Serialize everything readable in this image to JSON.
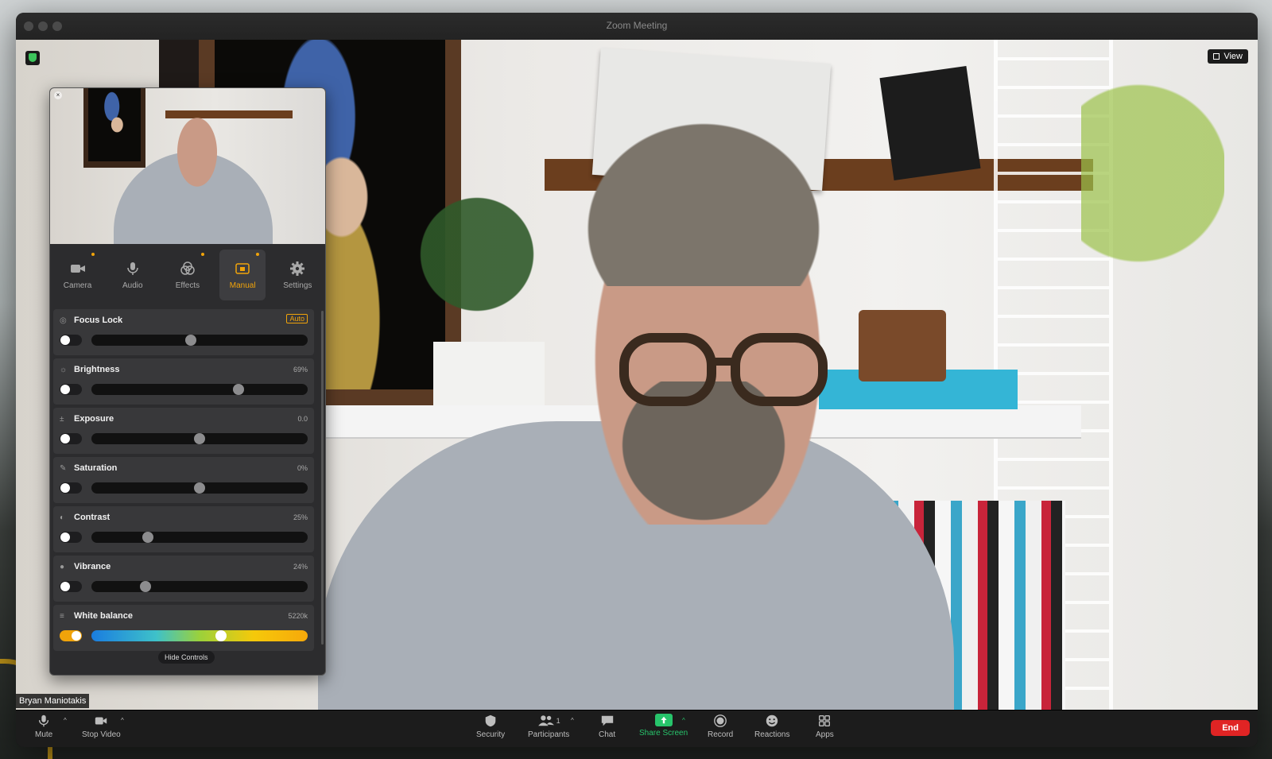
{
  "window": {
    "title": "Zoom Meeting"
  },
  "video": {
    "participant_name": "Bryan Maniotakis",
    "view_label": "View"
  },
  "panel": {
    "tabs": [
      {
        "label": "Camera",
        "icon": "camera-icon",
        "active": false,
        "dot": true
      },
      {
        "label": "Audio",
        "icon": "microphone-icon",
        "active": false,
        "dot": false
      },
      {
        "label": "Effects",
        "icon": "effects-icon",
        "active": false,
        "dot": true
      },
      {
        "label": "Manual",
        "icon": "manual-icon",
        "active": true,
        "dot": true
      },
      {
        "label": "Settings",
        "icon": "gear-icon",
        "active": false,
        "dot": false
      }
    ],
    "sliders": [
      {
        "label": "Focus Lock",
        "value": "Auto",
        "badge": true,
        "position": 0.46,
        "toggle": false
      },
      {
        "label": "Brightness",
        "value": "69%",
        "badge": false,
        "position": 0.68,
        "toggle": false
      },
      {
        "label": "Exposure",
        "value": "0.0",
        "badge": false,
        "position": 0.5,
        "toggle": false
      },
      {
        "label": "Saturation",
        "value": "0%",
        "badge": false,
        "position": 0.5,
        "toggle": false
      },
      {
        "label": "Contrast",
        "value": "25%",
        "badge": false,
        "position": 0.26,
        "toggle": false
      },
      {
        "label": "Vibrance",
        "value": "24%",
        "badge": false,
        "position": 0.25,
        "toggle": false
      },
      {
        "label": "White balance",
        "value": "5220k",
        "badge": false,
        "position": 0.6,
        "toggle": true
      }
    ],
    "hide_controls_label": "Hide Controls"
  },
  "toolbar": {
    "mute_label": "Mute",
    "stop_video_label": "Stop Video",
    "security_label": "Security",
    "participants_label": "Participants",
    "participants_count": "1",
    "chat_label": "Chat",
    "share_screen_label": "Share Screen",
    "record_label": "Record",
    "reactions_label": "Reactions",
    "apps_label": "Apps",
    "end_label": "End"
  },
  "colors": {
    "accent": "#f0a30a",
    "share_green": "#27c46b",
    "end_red": "#e02424",
    "secure_green": "#3cc45b"
  }
}
